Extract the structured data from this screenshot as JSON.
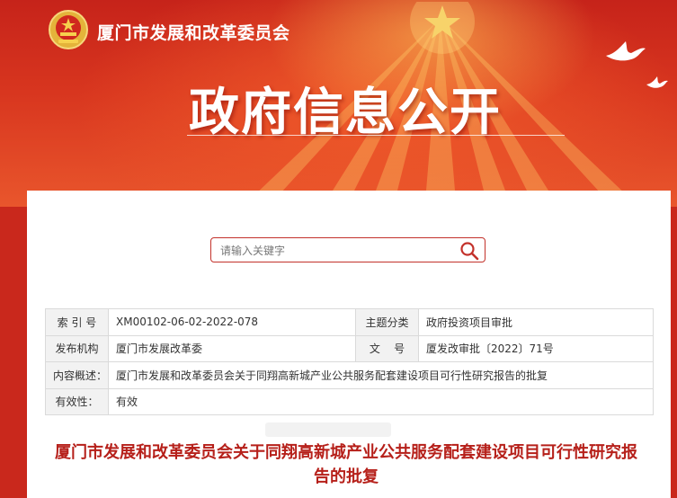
{
  "header": {
    "org_name": "厦门市发展和改革委员会",
    "section_title": "政府信息公开"
  },
  "search": {
    "placeholder": "请输入关键字"
  },
  "meta": {
    "index_label": "索 引 号",
    "index_value": "XM00102-06-02-2022-078",
    "topic_label": "主题分类",
    "topic_value": "政府投资项目审批",
    "publisher_label": "发布机构",
    "publisher_value": "厦门市发展改革委",
    "docno_label": "文    号",
    "docno_value": "厦发改审批〔2022〕71号",
    "summary_label": "内容概述：",
    "summary_value": "厦门市发展和改革委员会关于同翔高新城产业公共服务配套建设项目可行性研究报告的批复",
    "validity_label": "有效性：",
    "validity_value": "有效"
  },
  "document": {
    "title": "厦门市发展和改革委员会关于同翔高新城产业公共服务配套建设项目可行性研究报告的批复"
  },
  "colors": {
    "banner_red": "#c9281c",
    "accent_red": "#b6201a",
    "label_bg": "#f2f2f2"
  }
}
